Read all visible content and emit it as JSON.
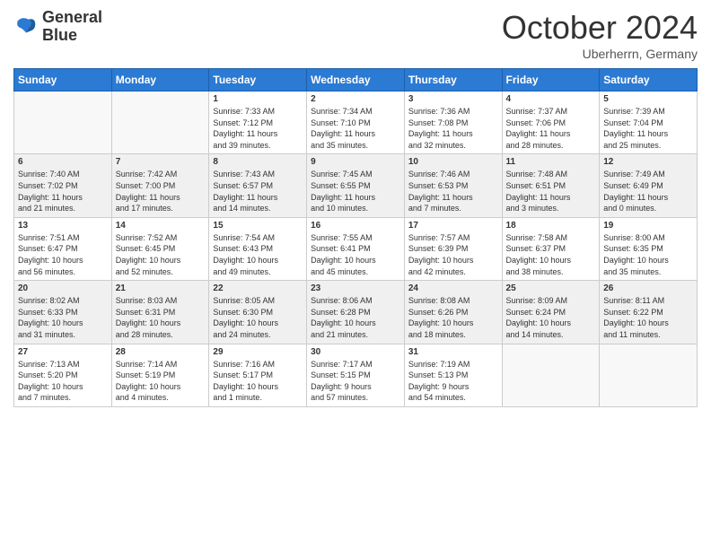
{
  "header": {
    "logo_line1": "General",
    "logo_line2": "Blue",
    "month": "October 2024",
    "location": "Uberherrn, Germany"
  },
  "day_headers": [
    "Sunday",
    "Monday",
    "Tuesday",
    "Wednesday",
    "Thursday",
    "Friday",
    "Saturday"
  ],
  "weeks": [
    {
      "row_class": "row-1",
      "days": [
        {
          "num": "",
          "info": "",
          "empty": true
        },
        {
          "num": "",
          "info": "",
          "empty": true
        },
        {
          "num": "1",
          "info": "Sunrise: 7:33 AM\nSunset: 7:12 PM\nDaylight: 11 hours\nand 39 minutes."
        },
        {
          "num": "2",
          "info": "Sunrise: 7:34 AM\nSunset: 7:10 PM\nDaylight: 11 hours\nand 35 minutes."
        },
        {
          "num": "3",
          "info": "Sunrise: 7:36 AM\nSunset: 7:08 PM\nDaylight: 11 hours\nand 32 minutes."
        },
        {
          "num": "4",
          "info": "Sunrise: 7:37 AM\nSunset: 7:06 PM\nDaylight: 11 hours\nand 28 minutes."
        },
        {
          "num": "5",
          "info": "Sunrise: 7:39 AM\nSunset: 7:04 PM\nDaylight: 11 hours\nand 25 minutes."
        }
      ]
    },
    {
      "row_class": "row-2",
      "days": [
        {
          "num": "6",
          "info": "Sunrise: 7:40 AM\nSunset: 7:02 PM\nDaylight: 11 hours\nand 21 minutes."
        },
        {
          "num": "7",
          "info": "Sunrise: 7:42 AM\nSunset: 7:00 PM\nDaylight: 11 hours\nand 17 minutes."
        },
        {
          "num": "8",
          "info": "Sunrise: 7:43 AM\nSunset: 6:57 PM\nDaylight: 11 hours\nand 14 minutes."
        },
        {
          "num": "9",
          "info": "Sunrise: 7:45 AM\nSunset: 6:55 PM\nDaylight: 11 hours\nand 10 minutes."
        },
        {
          "num": "10",
          "info": "Sunrise: 7:46 AM\nSunset: 6:53 PM\nDaylight: 11 hours\nand 7 minutes."
        },
        {
          "num": "11",
          "info": "Sunrise: 7:48 AM\nSunset: 6:51 PM\nDaylight: 11 hours\nand 3 minutes."
        },
        {
          "num": "12",
          "info": "Sunrise: 7:49 AM\nSunset: 6:49 PM\nDaylight: 11 hours\nand 0 minutes."
        }
      ]
    },
    {
      "row_class": "row-3",
      "days": [
        {
          "num": "13",
          "info": "Sunrise: 7:51 AM\nSunset: 6:47 PM\nDaylight: 10 hours\nand 56 minutes."
        },
        {
          "num": "14",
          "info": "Sunrise: 7:52 AM\nSunset: 6:45 PM\nDaylight: 10 hours\nand 52 minutes."
        },
        {
          "num": "15",
          "info": "Sunrise: 7:54 AM\nSunset: 6:43 PM\nDaylight: 10 hours\nand 49 minutes."
        },
        {
          "num": "16",
          "info": "Sunrise: 7:55 AM\nSunset: 6:41 PM\nDaylight: 10 hours\nand 45 minutes."
        },
        {
          "num": "17",
          "info": "Sunrise: 7:57 AM\nSunset: 6:39 PM\nDaylight: 10 hours\nand 42 minutes."
        },
        {
          "num": "18",
          "info": "Sunrise: 7:58 AM\nSunset: 6:37 PM\nDaylight: 10 hours\nand 38 minutes."
        },
        {
          "num": "19",
          "info": "Sunrise: 8:00 AM\nSunset: 6:35 PM\nDaylight: 10 hours\nand 35 minutes."
        }
      ]
    },
    {
      "row_class": "row-4",
      "days": [
        {
          "num": "20",
          "info": "Sunrise: 8:02 AM\nSunset: 6:33 PM\nDaylight: 10 hours\nand 31 minutes."
        },
        {
          "num": "21",
          "info": "Sunrise: 8:03 AM\nSunset: 6:31 PM\nDaylight: 10 hours\nand 28 minutes."
        },
        {
          "num": "22",
          "info": "Sunrise: 8:05 AM\nSunset: 6:30 PM\nDaylight: 10 hours\nand 24 minutes."
        },
        {
          "num": "23",
          "info": "Sunrise: 8:06 AM\nSunset: 6:28 PM\nDaylight: 10 hours\nand 21 minutes."
        },
        {
          "num": "24",
          "info": "Sunrise: 8:08 AM\nSunset: 6:26 PM\nDaylight: 10 hours\nand 18 minutes."
        },
        {
          "num": "25",
          "info": "Sunrise: 8:09 AM\nSunset: 6:24 PM\nDaylight: 10 hours\nand 14 minutes."
        },
        {
          "num": "26",
          "info": "Sunrise: 8:11 AM\nSunset: 6:22 PM\nDaylight: 10 hours\nand 11 minutes."
        }
      ]
    },
    {
      "row_class": "row-5",
      "days": [
        {
          "num": "27",
          "info": "Sunrise: 7:13 AM\nSunset: 5:20 PM\nDaylight: 10 hours\nand 7 minutes."
        },
        {
          "num": "28",
          "info": "Sunrise: 7:14 AM\nSunset: 5:19 PM\nDaylight: 10 hours\nand 4 minutes."
        },
        {
          "num": "29",
          "info": "Sunrise: 7:16 AM\nSunset: 5:17 PM\nDaylight: 10 hours\nand 1 minute."
        },
        {
          "num": "30",
          "info": "Sunrise: 7:17 AM\nSunset: 5:15 PM\nDaylight: 9 hours\nand 57 minutes."
        },
        {
          "num": "31",
          "info": "Sunrise: 7:19 AM\nSunset: 5:13 PM\nDaylight: 9 hours\nand 54 minutes."
        },
        {
          "num": "",
          "info": "",
          "empty": true
        },
        {
          "num": "",
          "info": "",
          "empty": true
        }
      ]
    }
  ]
}
